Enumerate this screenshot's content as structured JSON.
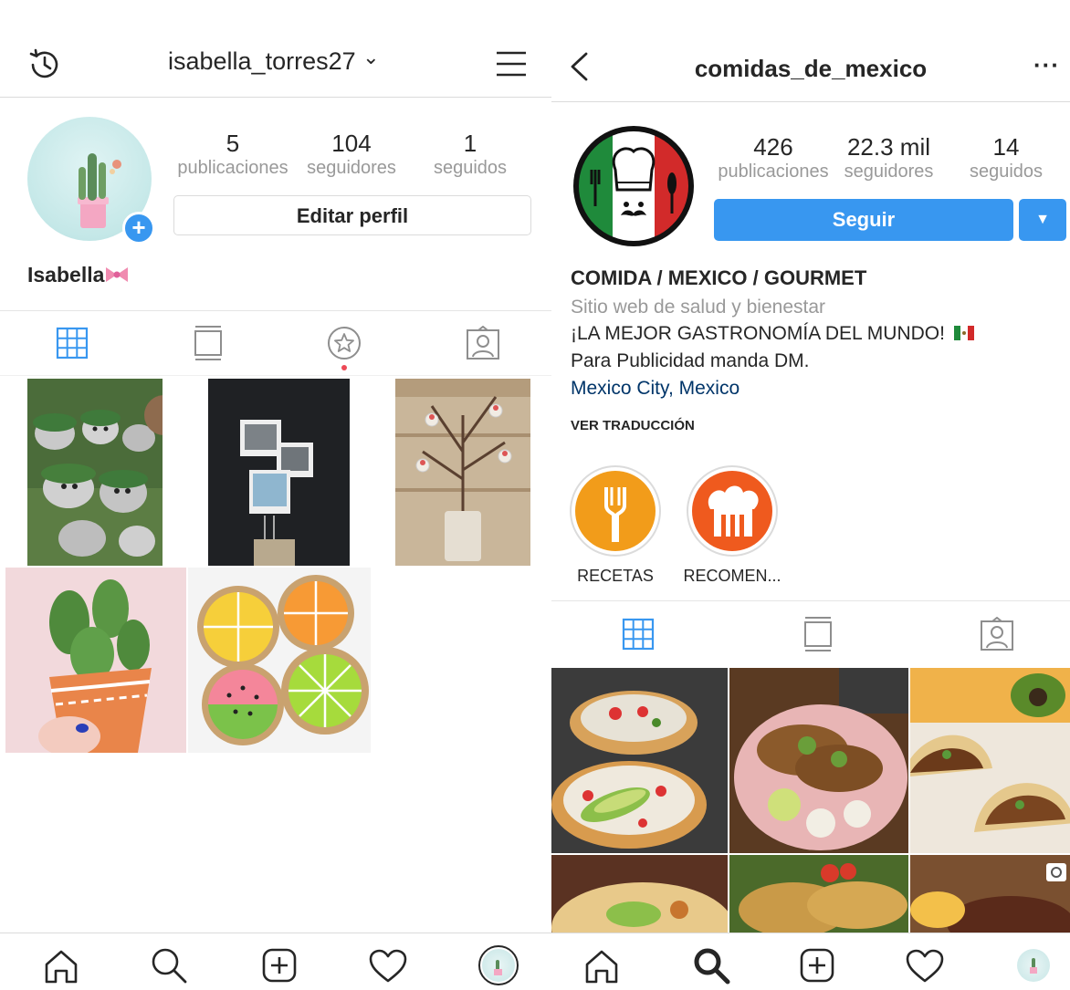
{
  "left": {
    "header": {
      "username": "isabella_torres27",
      "chevron": "⌄"
    },
    "stats": [
      {
        "value": "5",
        "label": "publicaciones"
      },
      {
        "value": "104",
        "label": "seguidores"
      },
      {
        "value": "1",
        "label": "seguidos"
      }
    ],
    "edit_profile": "Editar perfil",
    "display_name": "Isabella",
    "add_badge": "+"
  },
  "right": {
    "header": {
      "username": "comidas_de_mexico",
      "more": "···"
    },
    "stats": [
      {
        "value": "426",
        "label": "publicaciones"
      },
      {
        "value": "22.3 mil",
        "label": "seguidores"
      },
      {
        "value": "14",
        "label": "seguidos"
      }
    ],
    "follow": "Seguir",
    "follow_dropdown": "▼",
    "bio": {
      "name": "COMIDA / MEXICO / GOURMET",
      "category": "Sitio web de salud y bienestar",
      "line1": "¡LA MEJOR GASTRONOMÍA DEL MUNDO!",
      "line2": "Para Publicidad manda DM.",
      "location": "Mexico City, Mexico",
      "translate": "VER TRADUCCIÓN"
    },
    "highlights": [
      {
        "label": "RECETAS"
      },
      {
        "label": "RECOMEN..."
      }
    ]
  },
  "colors": {
    "accent": "#3897f0",
    "grid_active": "#3897f0",
    "link": "#003569",
    "notify": "#ed4956"
  }
}
